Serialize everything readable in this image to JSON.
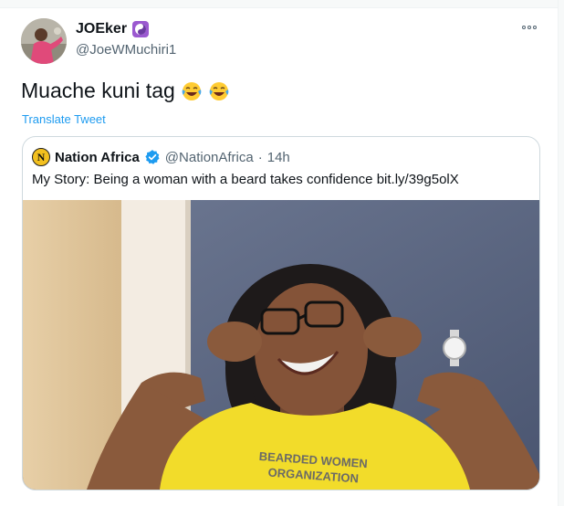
{
  "tweet": {
    "display_name": "JOEker",
    "handle": "@JoeWMuchiri1",
    "text": "Muache kuni tag",
    "translate_label": "Translate Tweet",
    "name_emoji_icon": "yin-yang-icon",
    "text_emoji_icon": "face-with-tears-of-joy-icon"
  },
  "quoted": {
    "display_name": "Nation Africa",
    "verified_icon": "verified-badge-icon",
    "handle": "@NationAfrica",
    "separator": "·",
    "time": "14h",
    "text": "My Story: Being a woman with a beard takes confidence bit.ly/39g5olX",
    "logo_letter": "N",
    "photo_shirt_line1": "BEARDED WOMEN",
    "photo_shirt_line2": "ORGANIZATION"
  },
  "colors": {
    "link": "#1d9bf0",
    "secondary_text": "#536471",
    "verified": "#1d9bf0",
    "shirt": "#f2dc2a",
    "logo_bg": "#f3c01e"
  }
}
